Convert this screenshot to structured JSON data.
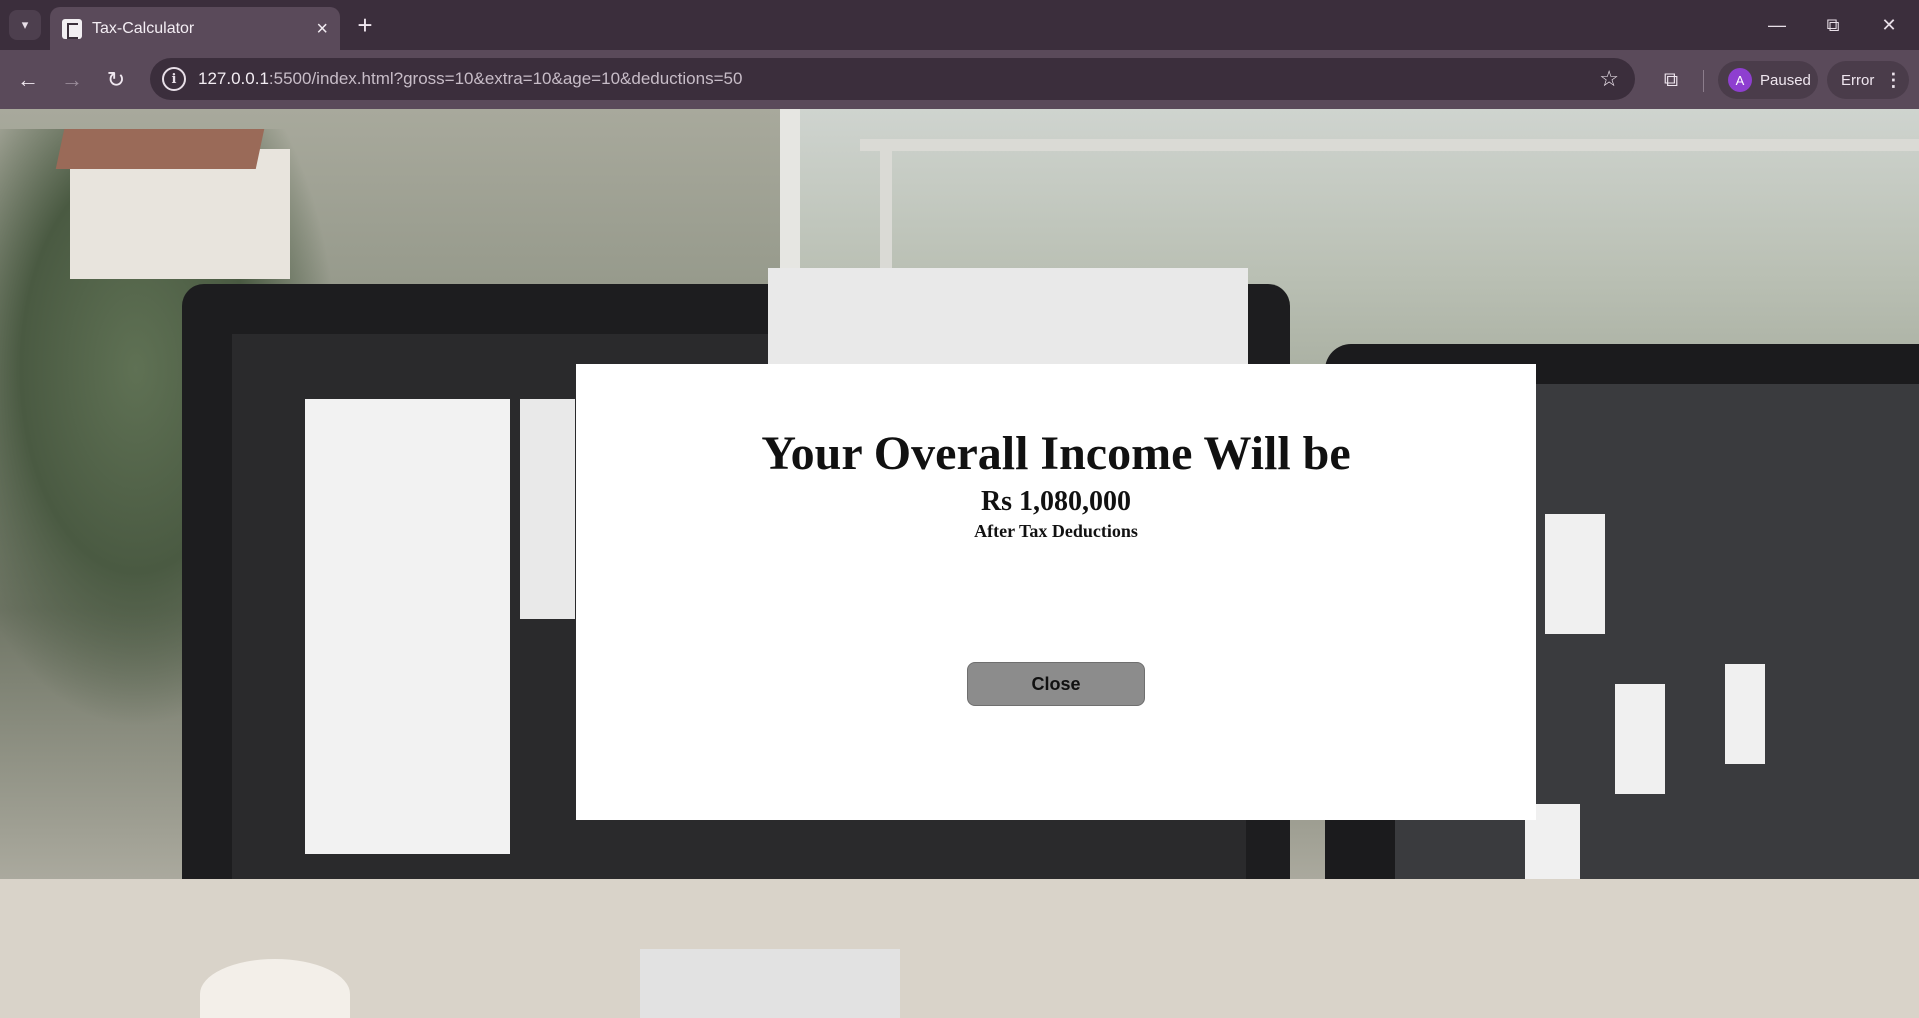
{
  "browser": {
    "tab": {
      "title": "Tax-Calculator"
    },
    "address_bar": {
      "url_host": "127.0.0.1",
      "url_rest": ":5500/index.html?gross=10&extra=10&age=10&deductions=50"
    },
    "profile": {
      "initial": "A",
      "status": "Paused"
    },
    "error_label": "Error"
  },
  "modal": {
    "heading": "Your Overall Income Will be",
    "amount": "Rs 1,080,000",
    "subtitle": "After Tax Deductions",
    "close_label": "Close"
  },
  "colors": {
    "chrome_dark": "#3b2e3c",
    "chrome_toolbar": "#5a4a5a",
    "avatar": "#8e3fd0",
    "close_button": "#8c8c8c",
    "modal_bg": "#ffffff"
  }
}
